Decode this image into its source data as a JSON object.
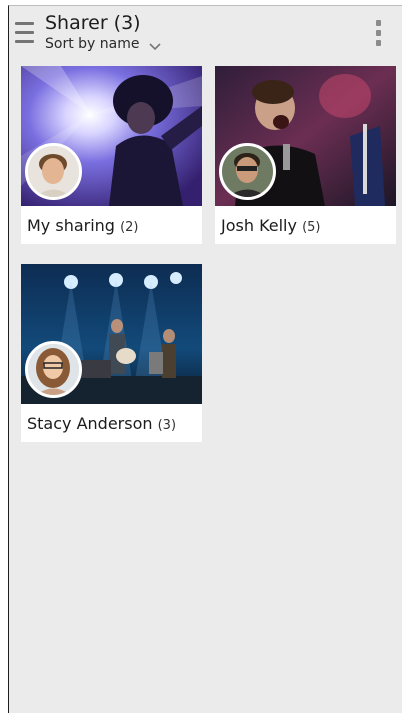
{
  "header": {
    "menu_icon": "hamburger-menu-icon",
    "title": "Sharer (3)",
    "sort_label": "Sort by name",
    "sort_icon": "chevron-down-icon",
    "overflow_icon": "overflow-menu-icon"
  },
  "sharers": [
    {
      "name": "My sharing",
      "count": "(2)"
    },
    {
      "name": "Josh Kelly",
      "count": "(5)"
    },
    {
      "name": "Stacy Anderson",
      "count": "(3)"
    }
  ],
  "colors": {
    "background": "#ebebeb",
    "card": "#ffffff",
    "text": "#1c1c1c",
    "icon": "#757575"
  }
}
